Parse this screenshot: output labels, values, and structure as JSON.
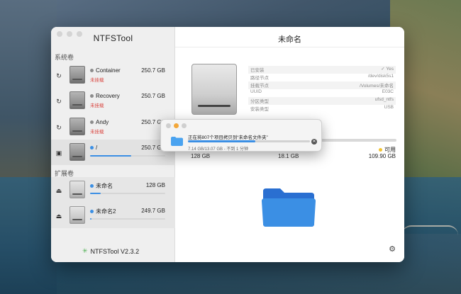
{
  "sidebar": {
    "app_title": "NTFSTool",
    "section_system": "系统卷",
    "section_ext": "扩展卷",
    "system_volumes": [
      {
        "name": "Container",
        "size": "250.7 GB",
        "status": "未挂载"
      },
      {
        "name": "Recovery",
        "size": "250.7 GB",
        "status": "未挂载"
      },
      {
        "name": "Andy",
        "size": "250.7 GB",
        "status": "未挂载"
      },
      {
        "name": "/",
        "size": "250.7 GB",
        "usage": 0.55
      }
    ],
    "ext_volumes": [
      {
        "name": "未命名",
        "size": "128 GB",
        "usage": 0.14
      },
      {
        "name": "未命名2",
        "size": "249.7 GB",
        "usage": 0.02
      }
    ],
    "footer_version": "NTFSTool V2.3.2"
  },
  "main": {
    "title": "未命名",
    "info": [
      {
        "label": "已安装",
        "value": "✓ Yes"
      },
      {
        "label": "路径节点",
        "value": "/dev/disk5s1"
      },
      {
        "label": "挂载节点",
        "value": "/Volumes/未命名"
      },
      {
        "label": "UUID",
        "value": "E03C"
      },
      {
        "label": "分区类型",
        "value": "ufsd_ntfs"
      },
      {
        "label": "安装类型",
        "value": "USB"
      }
    ],
    "usage_left": "128 GB",
    "usage_mid": "18.1 GB",
    "avail_label": "可用",
    "avail_value": "109.90 GB",
    "usage_fraction": 0.14
  },
  "dialog": {
    "title": "正在将807个项目拷贝到“未命名文件夹”",
    "subtitle": "7.14 GB/13.07 GB - 不到 1 分钟",
    "progress": 0.55
  },
  "colors": {
    "accent": "#3b8fe4",
    "unmounted": "#d9433d",
    "available": "#f2c230",
    "folder": "#2f7fe6"
  }
}
